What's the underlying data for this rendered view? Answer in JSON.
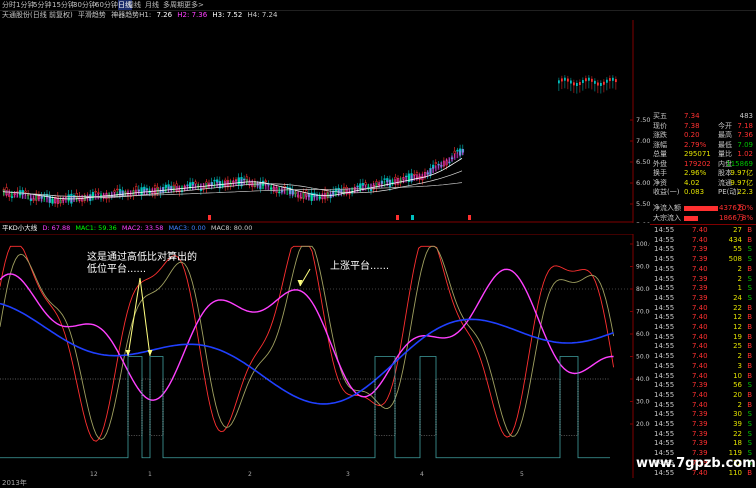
{
  "toolbar": {
    "items": [
      "分时",
      "1分钟",
      "5分钟",
      "15分钟",
      "30分钟",
      "60分钟",
      "日线",
      "周线",
      "月线",
      "多周期",
      "更多>"
    ],
    "active_index": 6
  },
  "main_info": {
    "stock": "天通股份(日线 前复权)",
    "indicator": "平滑趋势",
    "ind_name": "神器趋势H1:",
    "h1": "7.26",
    "h2label": "H4:",
    "h_values": [
      "7.26",
      "H2: 7.36",
      "H3: 7.52",
      "H4: 7.24"
    ]
  },
  "main_axis": [
    "7.50",
    "7.00",
    "6.50",
    "6.00",
    "5.50",
    "5.00"
  ],
  "kdj_info": {
    "title": "平KD小大线",
    "values": [
      "D: 67.88",
      "MAC1: 59.36",
      "MAC2: 33.58",
      "MAC3: 0.00",
      "MAC8: 80.00"
    ]
  },
  "kdj_axis": [
    "100.00",
    "90.00",
    "80.00",
    "70.00",
    "60.00",
    "50.00",
    "40.00",
    "30.00",
    "20.00"
  ],
  "quote": {
    "rows": [
      {
        "l": "买五",
        "v": "7.34",
        "v2": "",
        "r": "483",
        "vc": "#ff3030",
        "rc": "#c8c8c8"
      },
      {
        "l": "现价",
        "v": "7.38",
        "v2": "今开",
        "r": "7.18",
        "vc": "#ff3030",
        "rc": "#ff3030"
      },
      {
        "l": "涨跌",
        "v": "0.20",
        "v2": "最高",
        "r": "7.36",
        "vc": "#ff3030",
        "rc": "#ff3030"
      },
      {
        "l": "涨幅",
        "v": "2.79%",
        "v2": "最低",
        "r": "7.09",
        "vc": "#ff3030",
        "rc": "#00c000"
      },
      {
        "l": "总量",
        "v": "295071",
        "v2": "量比",
        "r": "1.02",
        "vc": "#e0e000",
        "rc": "#ff3030"
      },
      {
        "l": "外盘",
        "v": "179202",
        "v2": "内盘",
        "r": "115869",
        "vc": "#ff3030",
        "rc": "#00c000"
      },
      {
        "l": "换手",
        "v": "2.96%",
        "v2": "股本",
        "r": "9.97亿",
        "vc": "#e0e000",
        "rc": "#e0e000"
      },
      {
        "l": "净资",
        "v": "4.02",
        "v2": "流通",
        "r": "9.97亿",
        "vc": "#e0e000",
        "rc": "#e0e000"
      },
      {
        "l": "收益(一)",
        "v": "0.083",
        "v2": "PE(动)",
        "r": "22.3",
        "vc": "#e0e000",
        "rc": "#e0e000"
      }
    ],
    "flow": [
      {
        "l": "净流入额",
        "v": "4376万",
        "p": "20%",
        "c": "#ff3030"
      },
      {
        "l": "大宗流入",
        "v": "1866万",
        "p": "8%",
        "c": "#ff3030"
      }
    ]
  },
  "ticks": [
    {
      "t": "14:55",
      "p": "7.40",
      "v": "27",
      "d": "B"
    },
    {
      "t": "14:55",
      "p": "7.40",
      "v": "434",
      "d": "B"
    },
    {
      "t": "14:55",
      "p": "7.39",
      "v": "55",
      "d": "S"
    },
    {
      "t": "14:55",
      "p": "7.39",
      "v": "508",
      "d": "S"
    },
    {
      "t": "14:55",
      "p": "7.40",
      "v": "2",
      "d": "B"
    },
    {
      "t": "14:55",
      "p": "7.39",
      "v": "2",
      "d": "S"
    },
    {
      "t": "14:55",
      "p": "7.39",
      "v": "1",
      "d": "S"
    },
    {
      "t": "14:55",
      "p": "7.39",
      "v": "24",
      "d": "S"
    },
    {
      "t": "14:55",
      "p": "7.40",
      "v": "22",
      "d": "B"
    },
    {
      "t": "14:55",
      "p": "7.40",
      "v": "12",
      "d": "B"
    },
    {
      "t": "14:55",
      "p": "7.40",
      "v": "12",
      "d": "B"
    },
    {
      "t": "14:55",
      "p": "7.40",
      "v": "19",
      "d": "B"
    },
    {
      "t": "14:55",
      "p": "7.40",
      "v": "25",
      "d": "B"
    },
    {
      "t": "14:55",
      "p": "7.40",
      "v": "2",
      "d": "B"
    },
    {
      "t": "14:55",
      "p": "7.40",
      "v": "3",
      "d": "B"
    },
    {
      "t": "14:55",
      "p": "7.40",
      "v": "10",
      "d": "B"
    },
    {
      "t": "14:55",
      "p": "7.39",
      "v": "56",
      "d": "S"
    },
    {
      "t": "14:55",
      "p": "7.40",
      "v": "20",
      "d": "B"
    },
    {
      "t": "14:55",
      "p": "7.40",
      "v": "2",
      "d": "B"
    },
    {
      "t": "14:55",
      "p": "7.39",
      "v": "30",
      "d": "S"
    },
    {
      "t": "14:55",
      "p": "7.39",
      "v": "39",
      "d": "S"
    },
    {
      "t": "14:55",
      "p": "7.39",
      "v": "22",
      "d": "S"
    },
    {
      "t": "14:55",
      "p": "7.39",
      "v": "18",
      "d": "S"
    },
    {
      "t": "14:55",
      "p": "7.39",
      "v": "119",
      "d": "S"
    },
    {
      "t": "14:55",
      "p": "7.39",
      "v": "22",
      "d": "S"
    },
    {
      "t": "14:55",
      "p": "7.40",
      "v": "110",
      "d": "B"
    }
  ],
  "annotations": {
    "low_platform": "这是通过高低比对算出的\n低位平台......",
    "rise_platform": "上涨平台......"
  },
  "watermark": "www.7gpzb.com",
  "year_label": "2013年",
  "x_marks": [
    "12",
    "1",
    "2",
    "3",
    "4",
    "5"
  ]
}
